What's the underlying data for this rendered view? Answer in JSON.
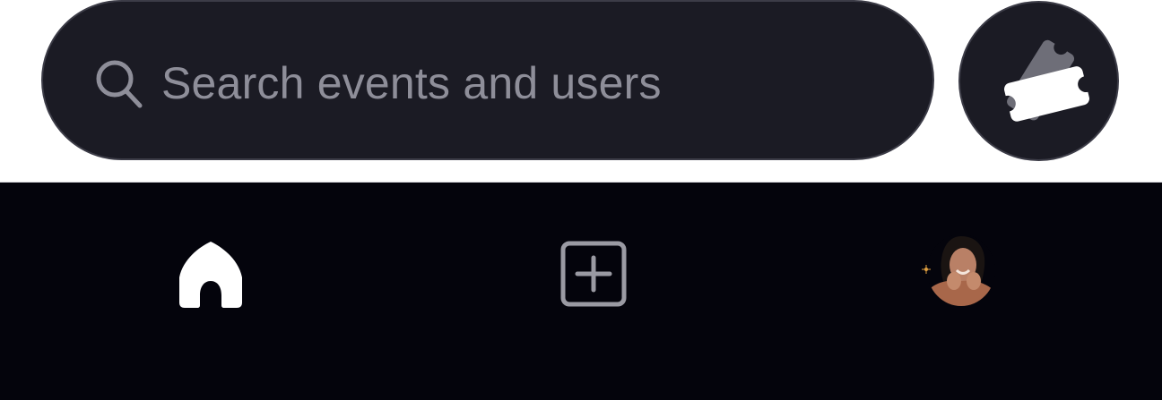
{
  "search": {
    "placeholder": "Search events and users",
    "icon": "search-icon"
  },
  "header": {
    "tickets_button_icon": "ticket-icon"
  },
  "bottom_nav": {
    "items": [
      {
        "name": "home",
        "icon": "home-icon",
        "active": true
      },
      {
        "name": "create",
        "icon": "plus-square-icon",
        "active": false
      },
      {
        "name": "profile",
        "icon": "avatar",
        "active": false
      }
    ]
  },
  "colors": {
    "search_bg": "#1b1b24",
    "search_border": "#3c3c47",
    "placeholder": "#8e8e99",
    "nav_bg": "#04040c",
    "active_icon": "#ffffff",
    "inactive_icon": "#9a9aa3"
  }
}
